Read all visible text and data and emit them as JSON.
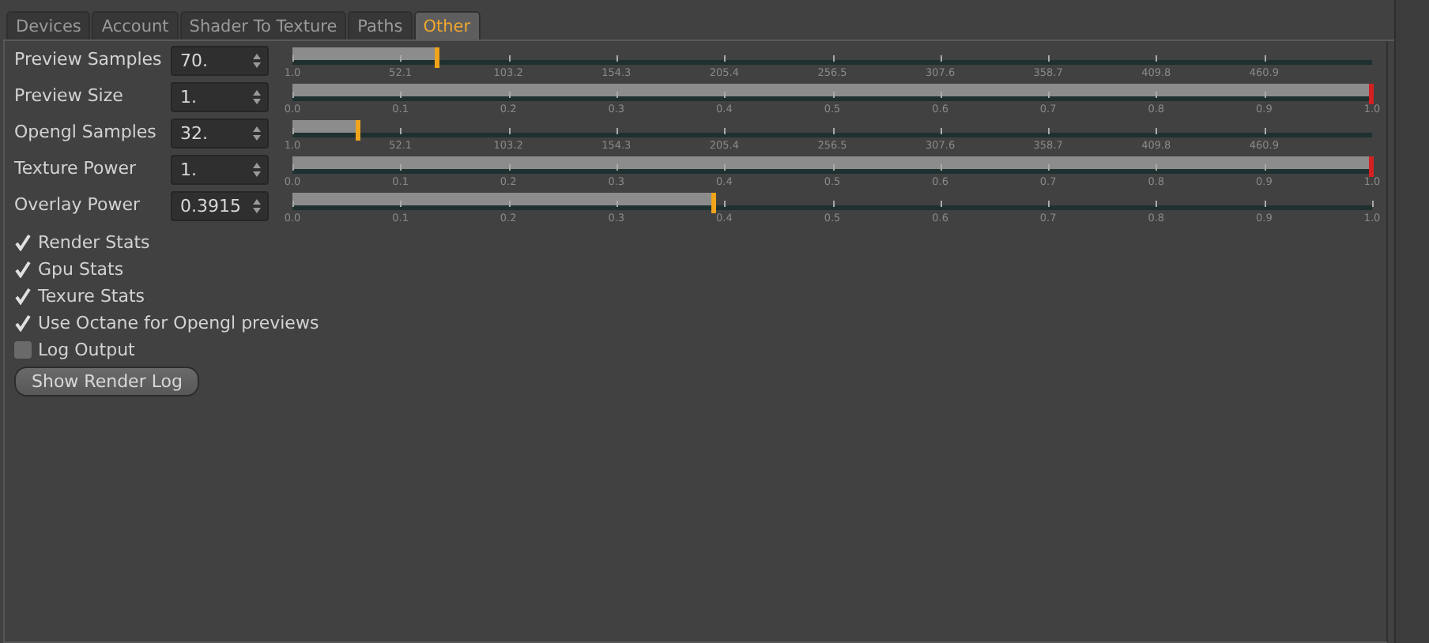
{
  "tabs": [
    {
      "label": "Devices",
      "selected": false
    },
    {
      "label": "Account",
      "selected": false
    },
    {
      "label": "Shader To Texture",
      "selected": false
    },
    {
      "label": "Paths",
      "selected": false
    },
    {
      "label": "Other",
      "selected": true
    }
  ],
  "sliders": [
    {
      "label": "Preview Samples",
      "value": "70.",
      "level": 0.135,
      "ticks": [
        "1.0",
        "52.1",
        "103.2",
        "154.3",
        "205.4",
        "256.5",
        "307.6",
        "358.7",
        "409.8",
        "460.9"
      ]
    },
    {
      "label": "Preview Size",
      "value": "1.",
      "level": 1,
      "ticks": [
        "0.0",
        "0.1",
        "0.2",
        "0.3",
        "0.4",
        "0.5",
        "0.6",
        "0.7",
        "0.8",
        "0.9",
        "1.0"
      ]
    },
    {
      "label": "Opengl Samples",
      "value": "32.",
      "level": 0.061,
      "ticks": [
        "1.0",
        "52.1",
        "103.2",
        "154.3",
        "205.4",
        "256.5",
        "307.6",
        "358.7",
        "409.8",
        "460.9"
      ]
    },
    {
      "label": "Texture Power",
      "value": "1.",
      "level": 1,
      "ticks": [
        "0.0",
        "0.1",
        "0.2",
        "0.3",
        "0.4",
        "0.5",
        "0.6",
        "0.7",
        "0.8",
        "0.9",
        "1.0"
      ]
    },
    {
      "label": "Overlay Power",
      "value": "0.3915",
      "level": 0.3915,
      "ticks": [
        "0.0",
        "0.1",
        "0.2",
        "0.3",
        "0.4",
        "0.5",
        "0.6",
        "0.7",
        "0.8",
        "0.9",
        "1.0"
      ]
    }
  ],
  "options": [
    {
      "label": "Render Stats",
      "checked": true
    },
    {
      "label": "Gpu Stats",
      "checked": true
    },
    {
      "label": "Texure Stats",
      "checked": true
    },
    {
      "label": "Use Octane for Opengl previews",
      "checked": true
    },
    {
      "label": "Log Output",
      "checked": false
    }
  ],
  "button": "Show Render Log"
}
